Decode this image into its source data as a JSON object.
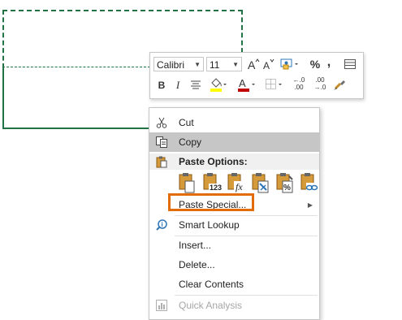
{
  "toolbar": {
    "font_name": "Calibri",
    "font_size": "11",
    "bold": "B",
    "italic": "I",
    "percent": "%",
    "comma": ",",
    "dec_inc_top": "←.0",
    "dec_inc_bottom": ".00",
    "dec_dec_top": ".00",
    "dec_dec_bottom": "→.0",
    "colors": {
      "highlight": "#ffff00",
      "font_color": "#c00000"
    }
  },
  "menu": {
    "cut": "Cut",
    "copy": "Copy",
    "paste_options": "Paste Options:",
    "paste_values_badge": "123",
    "paste_formula_badge": "fx",
    "paste_special": "Paste Special...",
    "smart_lookup": "Smart Lookup",
    "insert": "Insert...",
    "delete": "Delete...",
    "clear_contents": "Clear Contents",
    "quick_analysis": "Quick Analysis"
  },
  "colors": {
    "accent_green": "#217346",
    "highlight_box": "#e36c0a"
  }
}
